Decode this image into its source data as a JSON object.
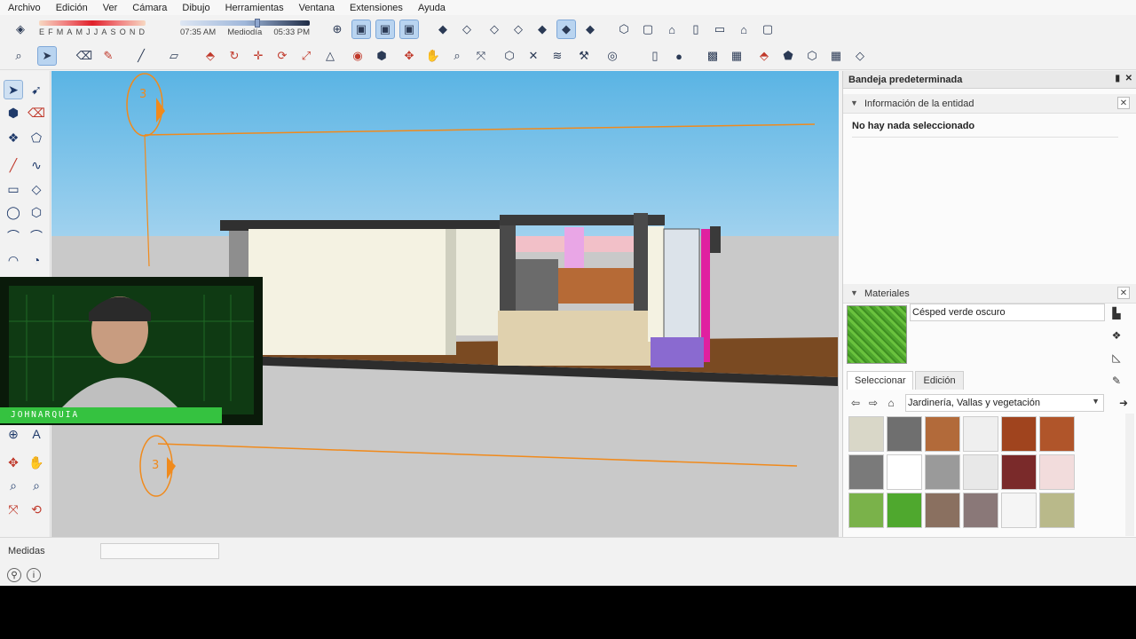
{
  "menu": [
    "Archivo",
    "Edición",
    "Ver",
    "Cámara",
    "Dibujo",
    "Herramientas",
    "Ventana",
    "Extensiones",
    "Ayuda"
  ],
  "shadows": {
    "months": [
      "E",
      "F",
      "M",
      "A",
      "M",
      "J",
      "J",
      "A",
      "S",
      "O",
      "N",
      "D"
    ],
    "time_start": "07:35 AM",
    "time_mid": "Mediodía",
    "time_end": "05:33 PM"
  },
  "panel": {
    "title": "Bandeja predeterminada",
    "entity_section": "Información de la entidad",
    "entity_status": "No hay nada seleccionado",
    "materials_section": "Materiales",
    "material_name": "Césped verde oscuro",
    "tab_select": "Seleccionar",
    "tab_edit": "Edición",
    "library": "Jardinería, Vallas y vegetación"
  },
  "status": {
    "measurements_label": "Medidas"
  },
  "webcam": {
    "name": "JOHNARQUIA"
  },
  "scene": {
    "section_tag_top": "3",
    "section_tag_bottom": "3"
  }
}
